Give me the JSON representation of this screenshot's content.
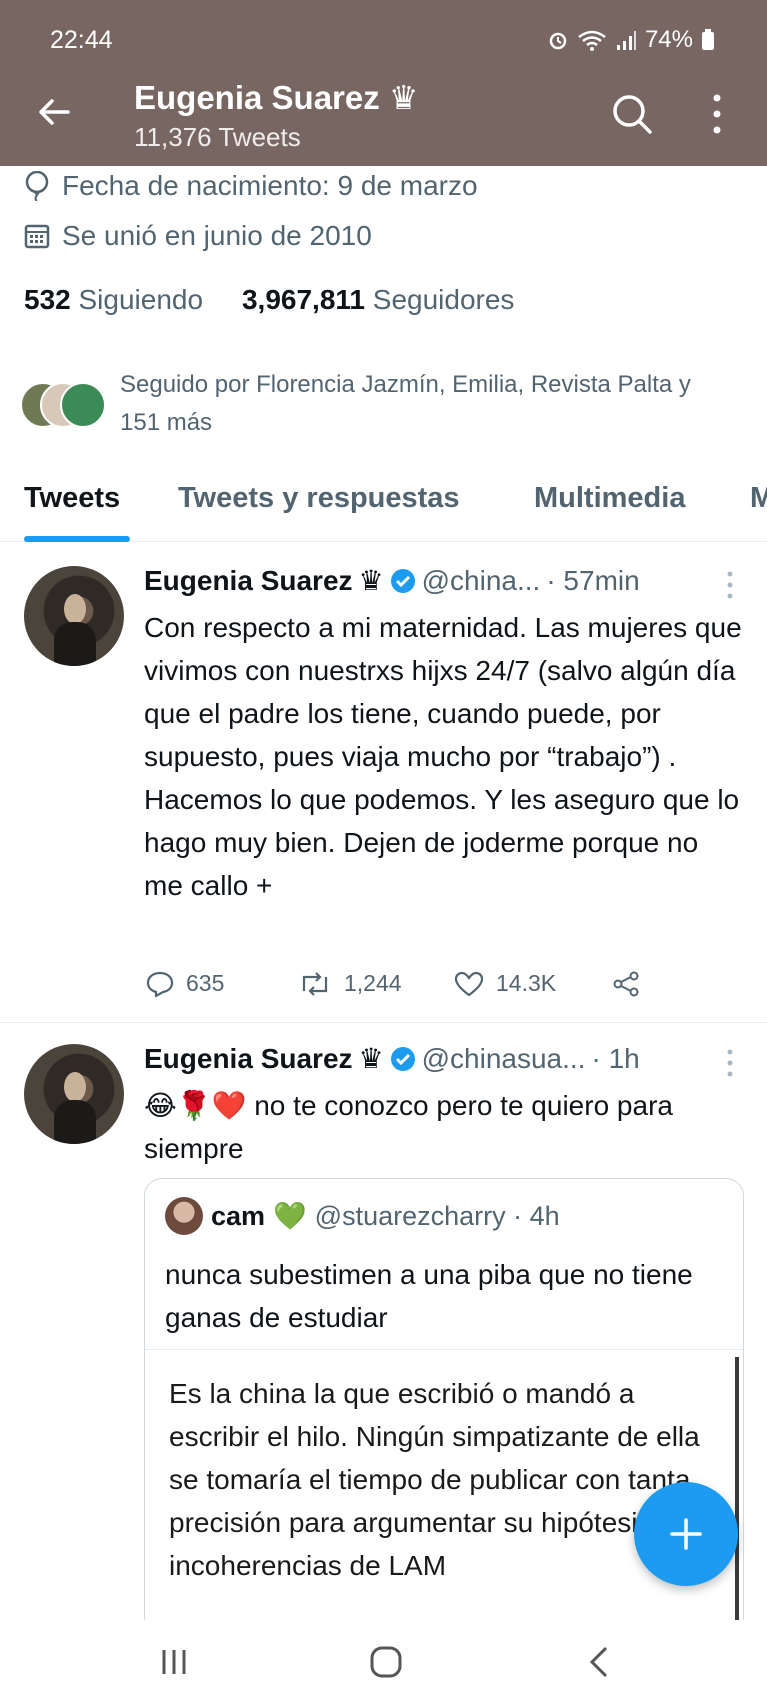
{
  "status_bar": {
    "time": "22:44",
    "battery": "74%"
  },
  "header": {
    "name": "Eugenia Suarez",
    "crown": "♛",
    "tweet_count": "11,376 Tweets"
  },
  "profile": {
    "birthday": "Fecha de nacimiento: 9 de marzo",
    "joined": "Se unió en junio de 2010",
    "following_count": "532",
    "following_label": "Siguiendo",
    "followers_count": "3,967,811",
    "followers_label": "Seguidores",
    "followed_by": "Seguido por Florencia Jazmín, Emilia, Revista Palta y 151 más"
  },
  "tabs": [
    {
      "label": "Tweets"
    },
    {
      "label": "Tweets y respuestas"
    },
    {
      "label": "Multimedia"
    },
    {
      "label": "M"
    }
  ],
  "tweets": [
    {
      "name": "Eugenia Suarez",
      "crown": "♛",
      "handle": "@china...",
      "time": "· 57min",
      "text": "Con respecto a mi maternidad. Las mujeres que vivimos con nuestrxs hijxs 24/7 (salvo algún día que el padre los tiene, cuando puede, por supuesto, pues viaja mucho por “trabajo”) . Hacemos lo que podemos. Y les aseguro que lo hago muy bien. Dejen de joderme porque no me callo +",
      "replies": "635",
      "retweets": "1,244",
      "likes": "14.3K"
    },
    {
      "name": "Eugenia Suarez",
      "crown": "♛",
      "handle": "@chinasua...",
      "time": "· 1h",
      "emoji": "😂🌹❤️",
      "text": "no te conozco pero te quiero para siempre",
      "quote": {
        "name": "cam",
        "emoji": "💚",
        "handle": "@stuarezcharry · 4h",
        "text": "nunca subestimen a una piba que no tiene ganas de estudiar",
        "image_text": "Es la china la que escribió o mandó a escribir el hilo. Ningún simpatizante de ella se tomaría el tiempo de publicar con tanta precisión para argumentar su hipótesis de incoherencias de LAM"
      }
    }
  ],
  "colors": {
    "header_bg": "#776662",
    "accent": "#1d9bf0",
    "secondary_text": "#536471"
  }
}
